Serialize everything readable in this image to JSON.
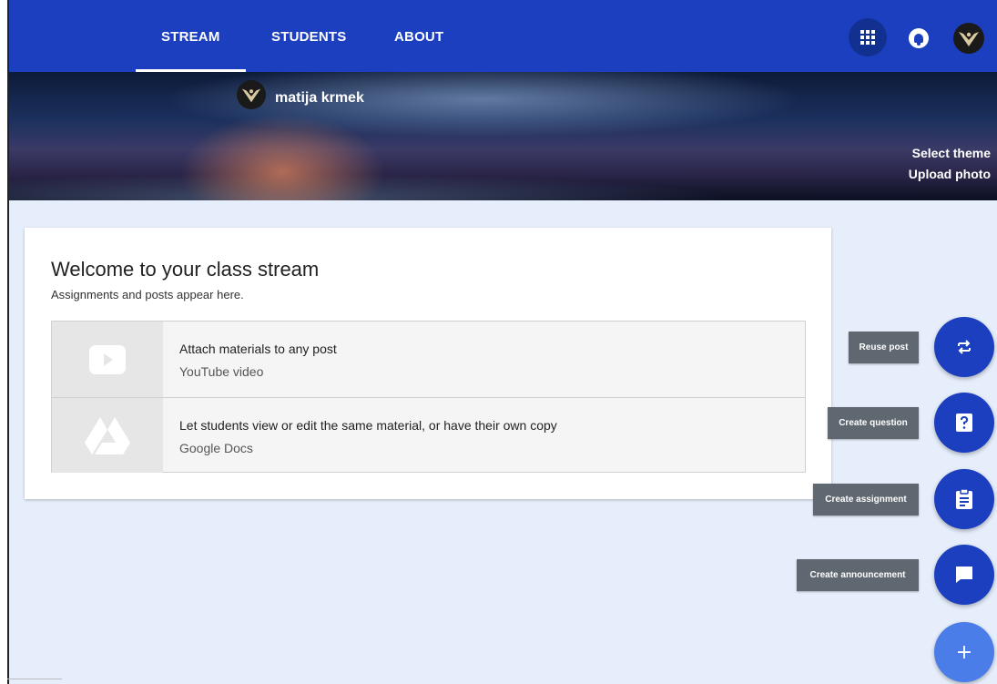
{
  "nav": {
    "tabs": [
      {
        "label": "STREAM",
        "active": true
      },
      {
        "label": "STUDENTS",
        "active": false
      },
      {
        "label": "ABOUT",
        "active": false
      }
    ],
    "icons": {
      "apps": "apps-grid-icon",
      "notifications": "notification-bell-icon",
      "account": "user-avatar"
    }
  },
  "banner": {
    "class_owner": "matija krmek",
    "select_theme": "Select theme",
    "upload_photo": "Upload photo"
  },
  "stream": {
    "title": "Welcome to your class stream",
    "subtitle": "Assignments and posts appear here.",
    "materials": [
      {
        "title": "Attach materials to any post",
        "subtitle": "YouTube video",
        "icon": "youtube-play-icon"
      },
      {
        "title": "Let students view or edit the same material, or have their own copy",
        "subtitle": "Google Docs",
        "icon": "google-drive-icon"
      }
    ]
  },
  "fab_menu": {
    "reuse_post": "Reuse post",
    "create_question": "Create question",
    "create_assignment": "Create assignment",
    "create_announcement": "Create announcement",
    "main_icon": "plus-icon"
  },
  "colors": {
    "primary": "#1b3fbf",
    "fab_main": "#4b7de8",
    "background": "#e6eefc",
    "tooltip": "#5f6770"
  }
}
